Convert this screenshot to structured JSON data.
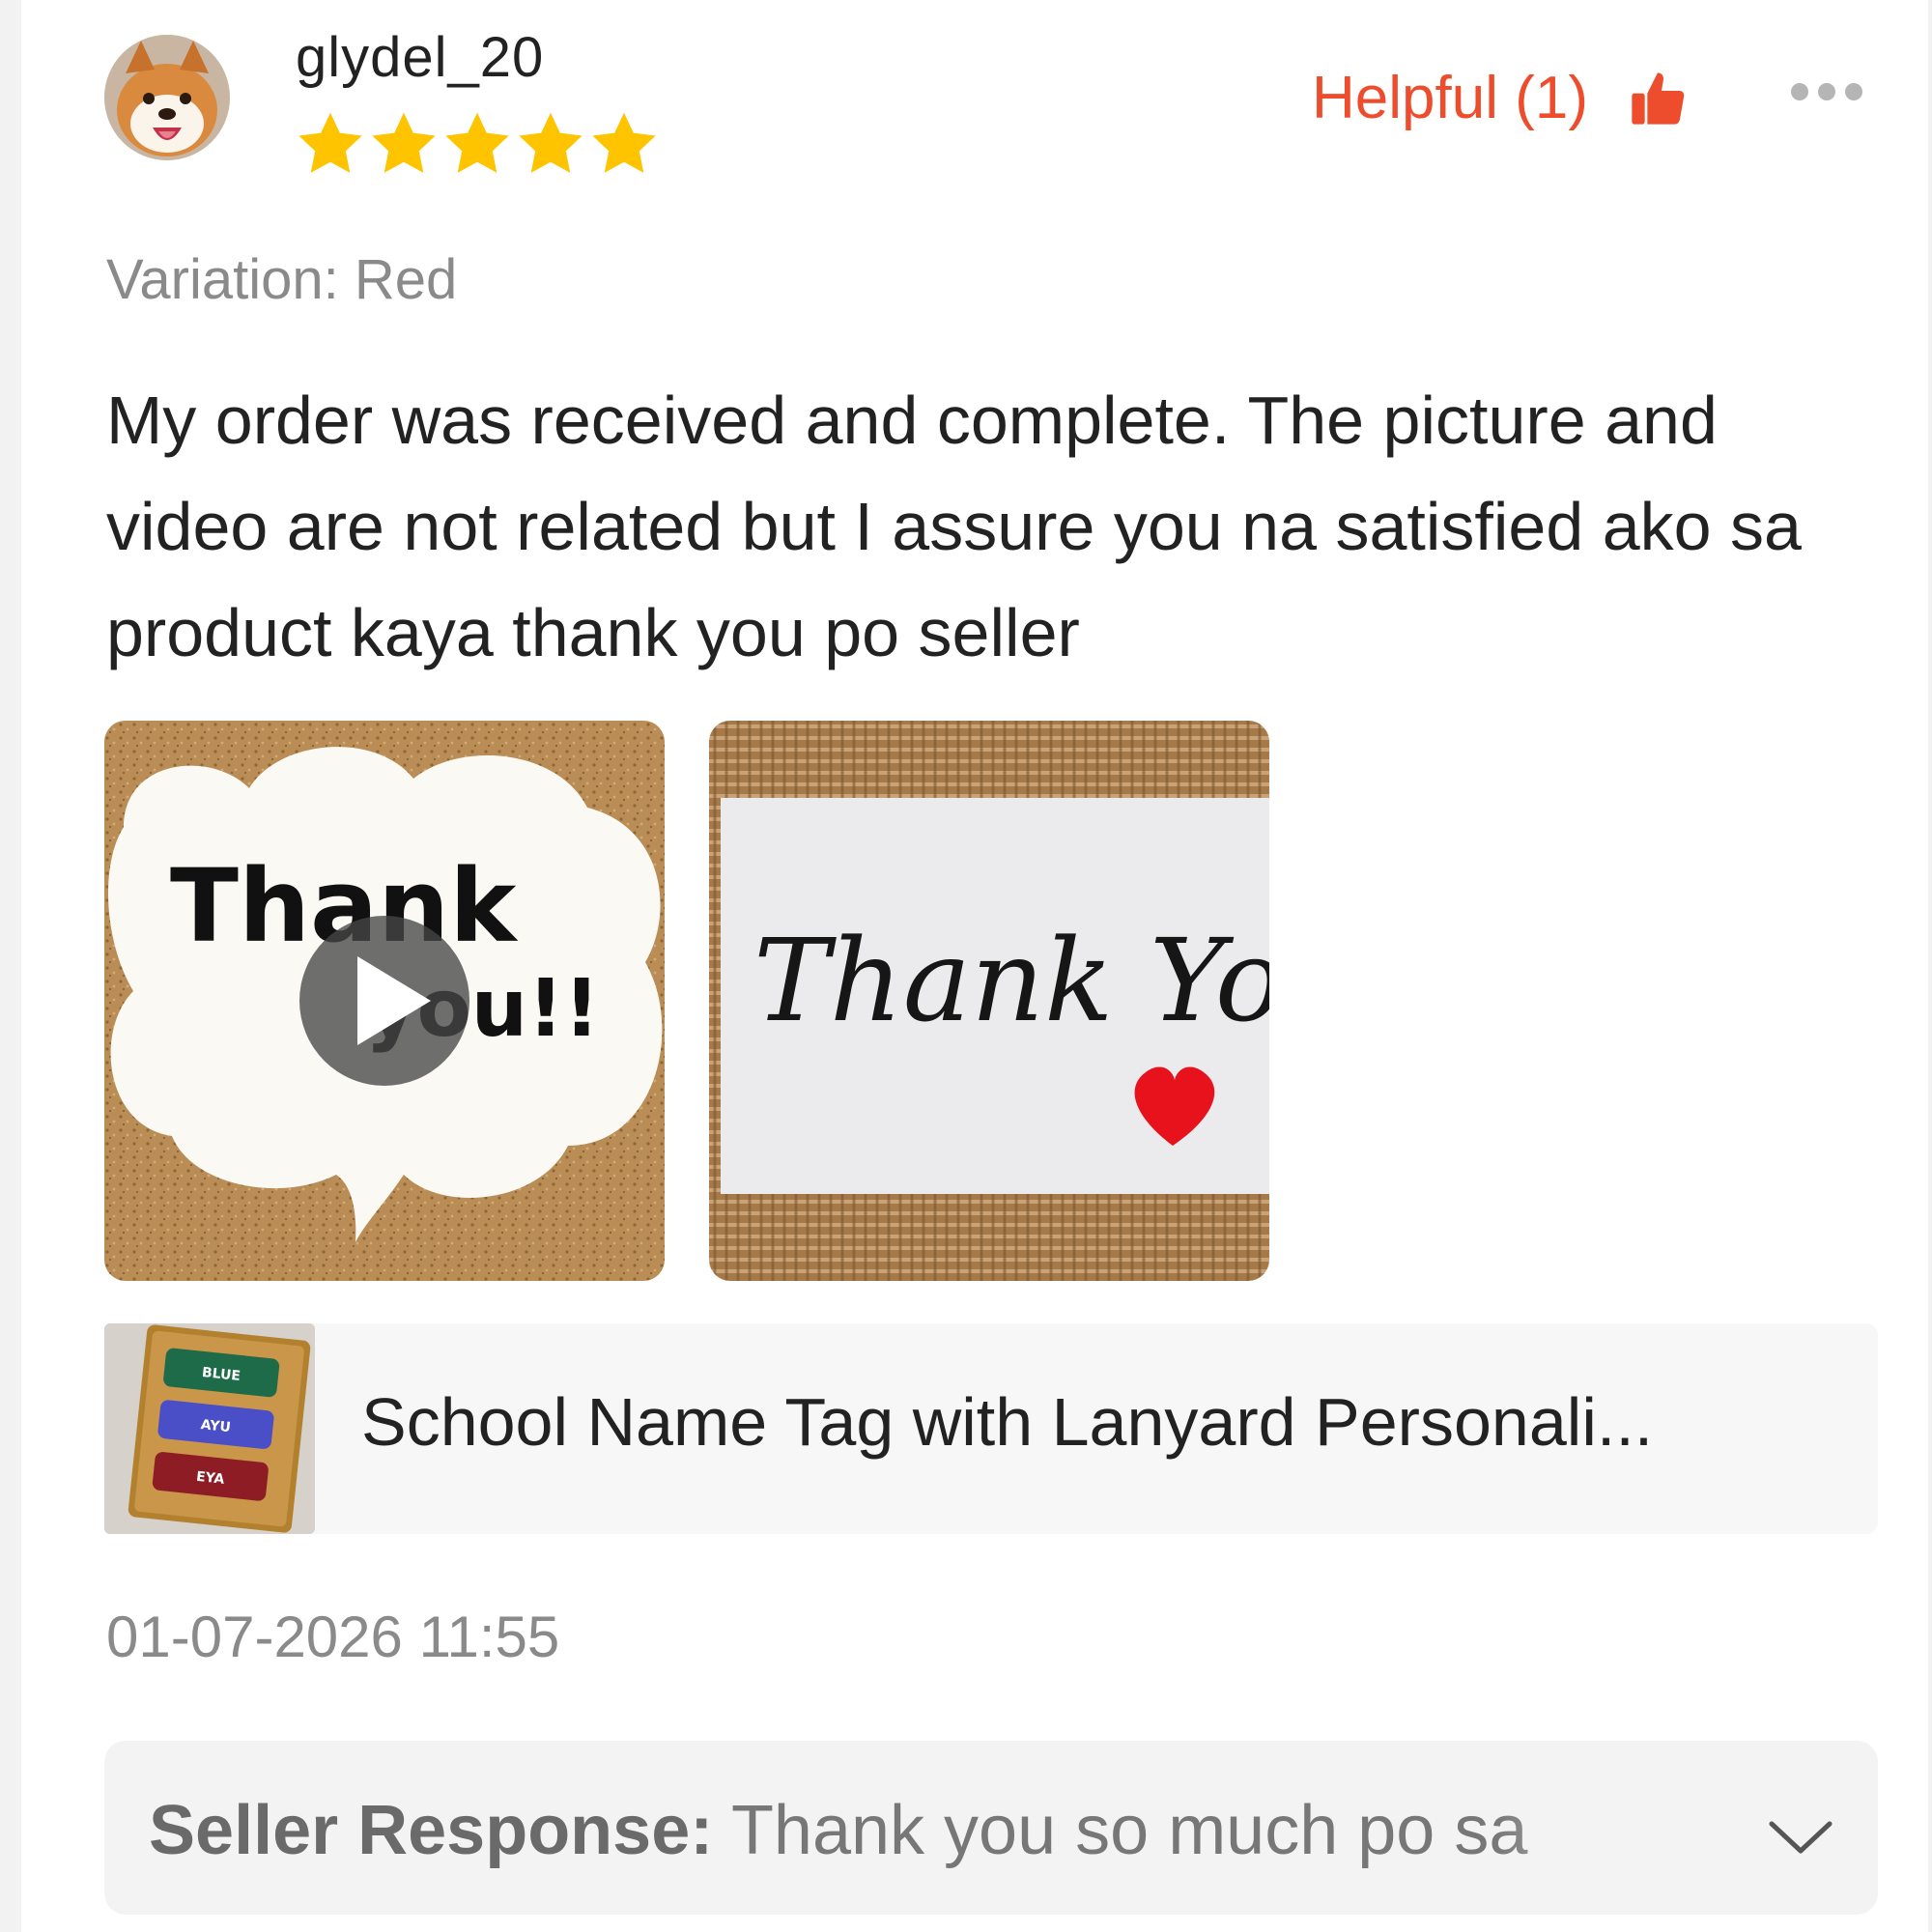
{
  "review": {
    "username": "glydel_20",
    "rating": 5,
    "helpful_label": "Helpful (1)",
    "variation": "Variation: Red",
    "text": "My order was received and complete. The picture and video are not related but I assure you na satisfied ako sa product kaya thank you po seller",
    "timestamp": "01-07-2026 11:55"
  },
  "media": {
    "video_caption_line1": "Thank",
    "video_caption_line2": "you!!",
    "photo_caption": "Thank You!"
  },
  "product": {
    "name": "School Name Tag with Lanyard Personali...",
    "tag_texts": [
      "BLUE",
      "AYU",
      "EYA"
    ]
  },
  "seller_response": {
    "label": "Seller Response:",
    "text": "Thank you so much po sa"
  },
  "colors": {
    "accent": "#ee4d2d",
    "star": "#ffc400",
    "heart": "#e8121c"
  },
  "icons": {
    "like": "thumbs-up-icon",
    "more": "more-dots-icon",
    "play": "play-icon",
    "expand": "chevron-down-icon"
  }
}
